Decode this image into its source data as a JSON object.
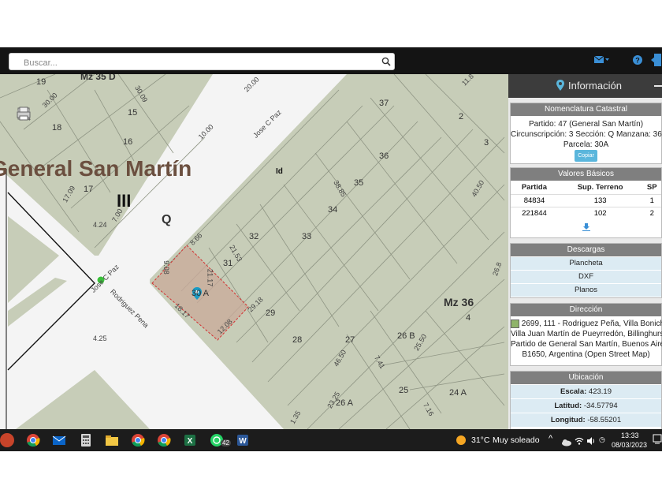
{
  "search": {
    "placeholder": "Buscar..."
  },
  "colors": {
    "accent": "#5ab6dc",
    "parcel_highlight": "#c9a99a",
    "pin": "#1a9bc4",
    "street": "#f4f4f4",
    "block": "#c7cdb8"
  },
  "map": {
    "title": "General San Martín",
    "section_numeral": "III",
    "zone_q": "Q",
    "manzana": "Mz 36",
    "mz_top": "Mz 35 D",
    "lot_id": "Id",
    "streets": {
      "jose_c_paz_upper": "Jose C Paz",
      "jose_c_paz_lower": "Jose C Paz",
      "rodriguez_pena": "Rodriguez Pena"
    },
    "lots": [
      "19",
      "18",
      "17",
      "16",
      "15",
      "37",
      "36",
      "35",
      "34",
      "33",
      "32",
      "31",
      "30 A",
      "29",
      "28",
      "27",
      "26 B",
      "26 A",
      "25",
      "24 A",
      "2",
      "3",
      "4"
    ],
    "measures": [
      "30.00",
      "30.09",
      "10.00",
      "20.00",
      "9.08",
      "21.17",
      "18.17",
      "12.08",
      "21.53",
      "38.85",
      "8.66",
      "29.18",
      "46.50",
      "25.50",
      "7.41",
      "23.25",
      "1.35",
      "7.16",
      "40.50",
      "4.25",
      "17.09",
      "7.00",
      "4.24",
      "26.8",
      "11.8"
    ]
  },
  "panel": {
    "title": "Información",
    "nomenclatura": {
      "header": "Nomenclatura Catastral",
      "partido": "Partido: 47 (General San Martín)",
      "circ": "Circunscripción: 3 Sección: Q Manzana: 36",
      "parcela": "Parcela: 30A",
      "copy": "Copiar"
    },
    "valores": {
      "header": "Valores Básicos",
      "columns": [
        "Partida",
        "Sup. Terreno",
        "SP"
      ],
      "rows": [
        [
          "84834",
          "133",
          "1"
        ],
        [
          "221844",
          "102",
          "2"
        ]
      ]
    },
    "descargas": {
      "header": "Descargas",
      "items": [
        "Plancheta",
        "DXF",
        "Planos"
      ]
    },
    "direccion": {
      "header": "Dirección",
      "lines": [
        "2699, 111 - Rodriguez Peña, Villa Bonich",
        "Villa Juan Martín de Pueyrredón, Billinghurst,",
        "Partido de General San Martín, Buenos Aires,",
        "B1650, Argentina (Open Street Map)"
      ]
    },
    "ubicacion": {
      "header": "Ubicación",
      "escala_label": "Escala:",
      "escala": "423.19",
      "latitud_label": "Latitud:",
      "latitud": "-34.57794",
      "longitud_label": "Longitud:",
      "longitud": "-58.55201"
    }
  },
  "taskbar": {
    "icons": [
      "powerpoint-icon",
      "chrome-icon",
      "mail-icon",
      "calculator-icon",
      "file-explorer-icon",
      "chrome-profile-icon",
      "chrome-profile2-icon",
      "excel-icon",
      "whatsapp-icon",
      "word-icon"
    ],
    "whatsapp_badge": "42",
    "weather": "31°C",
    "weather_desc": "Muy soleado",
    "time": "13:33",
    "date": "08/03/2023"
  }
}
